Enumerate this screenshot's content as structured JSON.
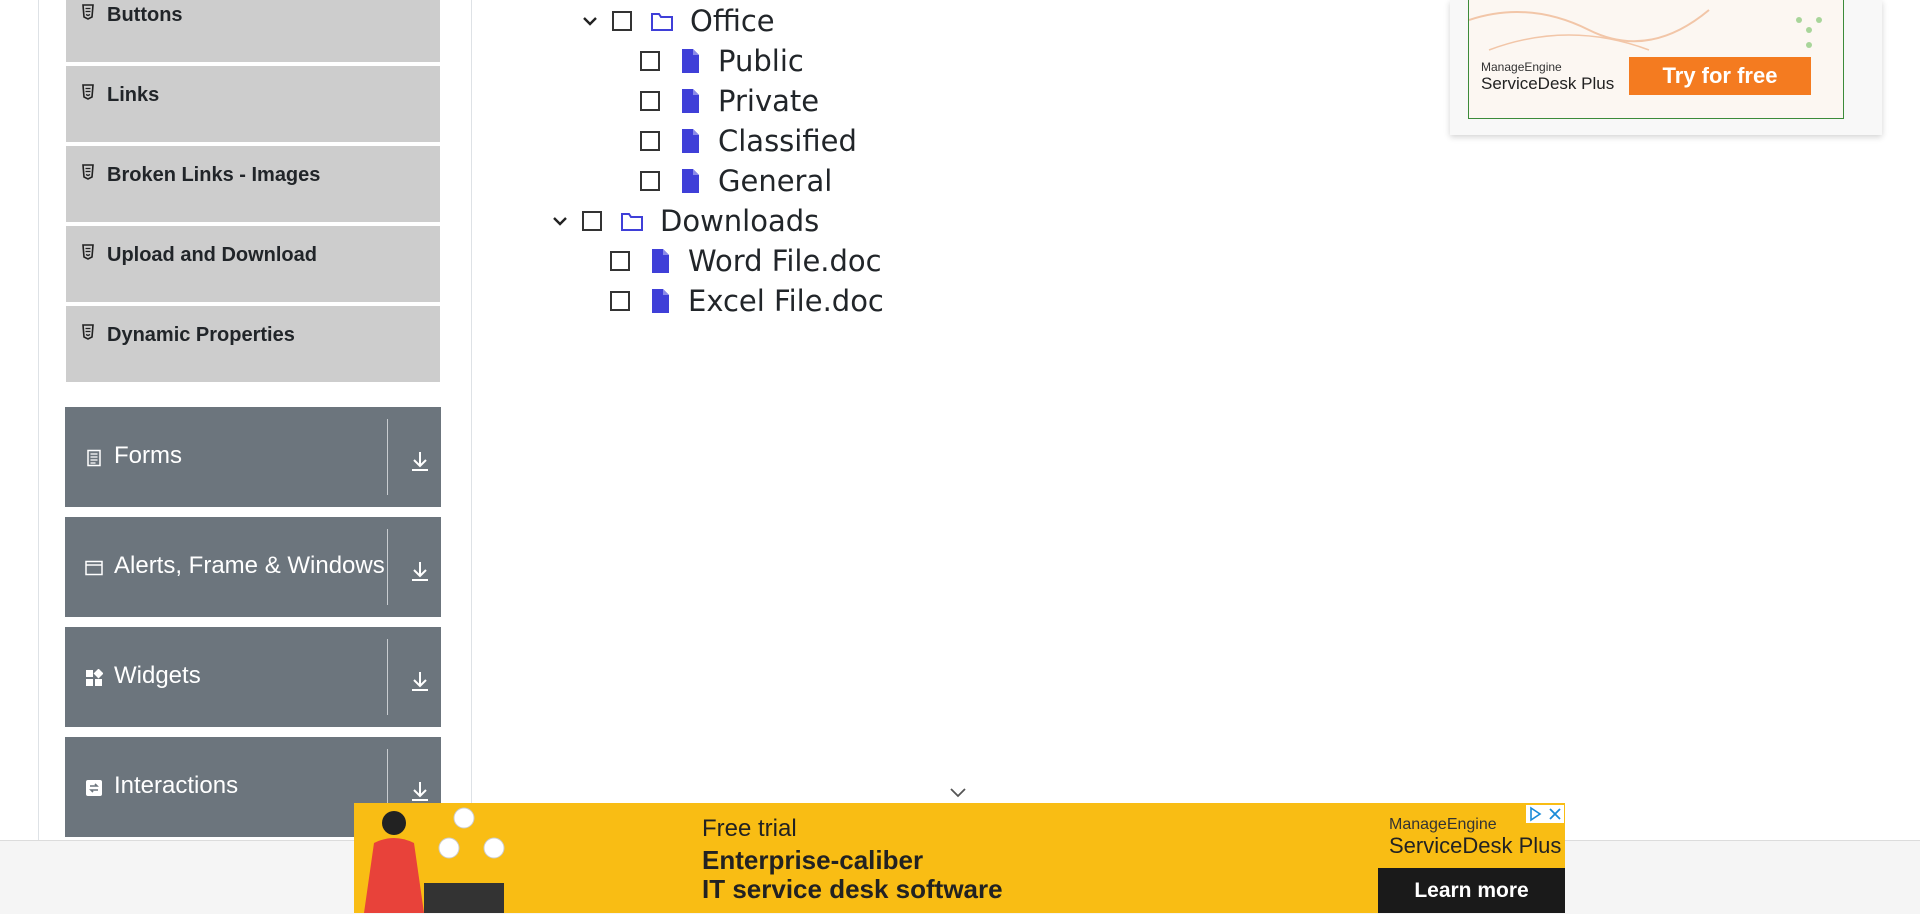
{
  "sidebar": {
    "elements_items": [
      {
        "label": "Buttons"
      },
      {
        "label": "Links"
      },
      {
        "label": "Broken Links - Images"
      },
      {
        "label": "Upload and Download"
      },
      {
        "label": "Dynamic Properties"
      }
    ],
    "groups": [
      {
        "label": "Forms",
        "icon": "document-icon"
      },
      {
        "label": "Alerts, Frame & Windows",
        "icon": "window-icon"
      },
      {
        "label": "Widgets",
        "icon": "widgets-icon"
      },
      {
        "label": "Interactions",
        "icon": "interactions-icon"
      }
    ]
  },
  "tree": {
    "nodes": [
      {
        "label": "Office",
        "type": "folder",
        "expanded": true
      },
      {
        "label": "Public",
        "type": "file"
      },
      {
        "label": "Private",
        "type": "file"
      },
      {
        "label": "Classified",
        "type": "file"
      },
      {
        "label": "General",
        "type": "file"
      },
      {
        "label": "Downloads",
        "type": "folder",
        "expanded": true
      },
      {
        "label": "Word File.doc",
        "type": "file"
      },
      {
        "label": "Excel File.doc",
        "type": "file"
      }
    ]
  },
  "ad_top": {
    "brand_line1": "ManageEngine",
    "brand_line2": "ServiceDesk Plus",
    "cta": "Try for free"
  },
  "ad_bottom": {
    "trial": "Free trial",
    "headline1": "Enterprise-caliber",
    "headline2": "IT service desk software",
    "brand_line1": "ManageEngine",
    "brand_line2": "ServiceDesk Plus",
    "cta": "Learn more"
  },
  "colors": {
    "sidebar_item_bg": "#cdcdcd",
    "group_bg": "#6c757d",
    "tree_icon": "#3f3fd8",
    "ad_bottom_bg": "#f9bd14",
    "ad_top_cta": "#f47b20"
  }
}
